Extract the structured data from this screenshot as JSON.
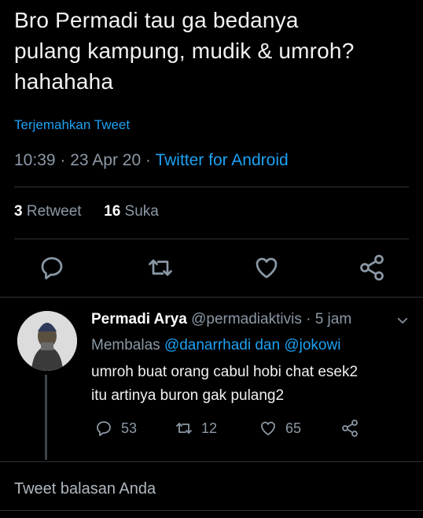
{
  "tweet": {
    "text": "Bro Permadi tau ga bedanya\npulang kampung, mudik & umroh?\nhahahaha",
    "translate_label": "Terjemahkan Tweet",
    "time": "10:39",
    "date": "23 Apr 20",
    "source": "Twitter for Android",
    "retweet_count": "3",
    "retweet_label": "Retweet",
    "like_count": "16",
    "like_label": "Suka"
  },
  "icons": {
    "reply": "comment-icon",
    "retweet": "retweet-icon",
    "like": "heart-icon",
    "share": "share-icon",
    "more": "chevron-down-icon"
  },
  "reply": {
    "name": "Permadi Arya",
    "handle": "@permadiaktivis",
    "age": "5 jam",
    "replying_prefix": "Membalas",
    "mention1": "@danarrhadi",
    "joiner": "dan",
    "mention2": "@jokowi",
    "text": "umroh buat orang cabul hobi chat esek2\nitu artinya buron gak pulang2",
    "reply_count": "53",
    "retweet_count": "12",
    "like_count": "65"
  },
  "composer": {
    "placeholder": "Tweet balasan Anda"
  },
  "colors": {
    "background": "#000000",
    "accent": "#1da1f2",
    "muted": "#8b98a5",
    "divider": "#2f3336"
  }
}
